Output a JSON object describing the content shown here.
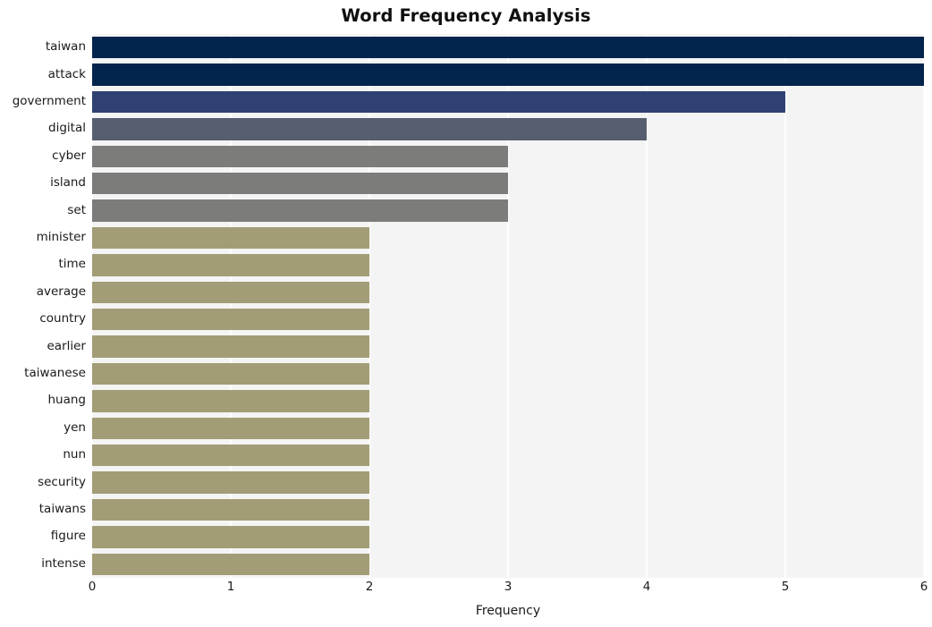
{
  "chart_data": {
    "type": "bar",
    "orientation": "horizontal",
    "title": "Word Frequency Analysis",
    "xlabel": "Frequency",
    "ylabel": "",
    "xlim": [
      0,
      6
    ],
    "xticks": [
      "0",
      "1",
      "2",
      "3",
      "4",
      "5",
      "6"
    ],
    "grid": true,
    "legend": null,
    "categories": [
      "taiwan",
      "attack",
      "government",
      "digital",
      "cyber",
      "island",
      "set",
      "minister",
      "time",
      "average",
      "country",
      "earlier",
      "taiwanese",
      "huang",
      "yen",
      "nun",
      "security",
      "taiwans",
      "figure",
      "intense"
    ],
    "values": [
      6,
      6,
      5,
      4,
      3,
      3,
      3,
      2,
      2,
      2,
      2,
      2,
      2,
      2,
      2,
      2,
      2,
      2,
      2,
      2
    ],
    "bar_colors": [
      "#03244d",
      "#03244d",
      "#2f4073",
      "#575e70",
      "#7c7c7a",
      "#7c7c7a",
      "#7c7c7a",
      "#a39d77",
      "#a39d77",
      "#a39d77",
      "#a39d77",
      "#a39d77",
      "#a39d77",
      "#a39d77",
      "#a39d77",
      "#a39d77",
      "#a39d77",
      "#a39d77",
      "#a39d77",
      "#a39d77"
    ]
  },
  "style": {
    "plot_background": "#f4f4f4",
    "gridline_color": "#fdfdfd",
    "figure_background": "#ffffff",
    "text_color": "#1a1a1a"
  }
}
